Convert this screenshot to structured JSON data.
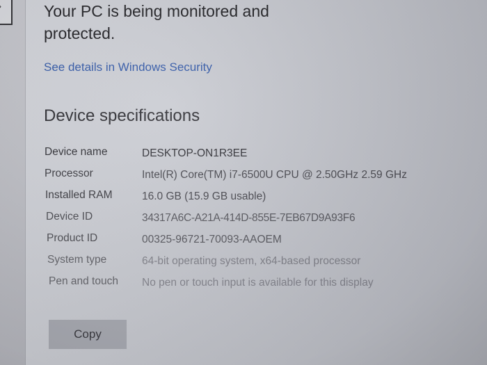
{
  "security": {
    "status_text": "Your PC is being monitored and protected.",
    "details_link": "See details in Windows Security"
  },
  "device_specifications": {
    "title": "Device specifications",
    "rows": [
      {
        "label": "Device name",
        "value": "DESKTOP-ON1R3EE"
      },
      {
        "label": "Processor",
        "value": "Intel(R) Core(TM) i7-6500U CPU @ 2.50GHz   2.59 GHz"
      },
      {
        "label": "Installed RAM",
        "value": "16.0 GB (15.9 GB usable)"
      },
      {
        "label": "Device ID",
        "value": "34317A6C-A21A-414D-855E-7EB67D9A93F6"
      },
      {
        "label": "Product ID",
        "value": "00325-96721-70093-AAOEM"
      },
      {
        "label": "System type",
        "value": "64-bit operating system, x64-based processor"
      },
      {
        "label": "Pen and touch",
        "value": "No pen or touch input is available for this display"
      }
    ],
    "copy_button": "Copy"
  },
  "corner_glyph": "›"
}
